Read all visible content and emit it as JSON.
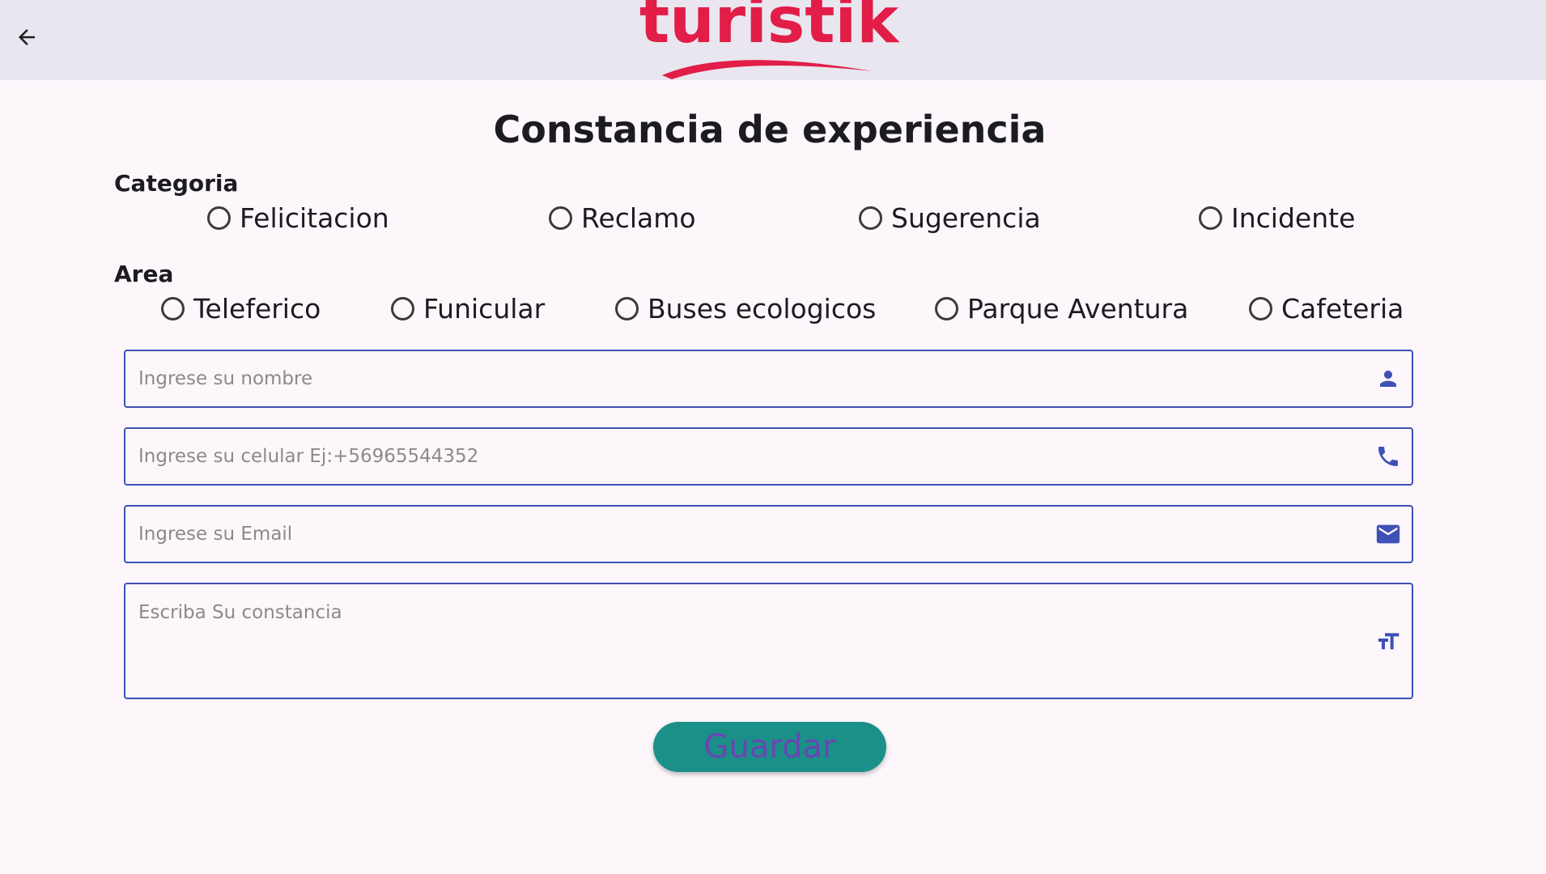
{
  "app_bar": {
    "logo_text": "turistik",
    "back_icon": "arrow-left-icon"
  },
  "page": {
    "title": "Constancia de experiencia"
  },
  "categoria": {
    "label": "Categoria",
    "options": [
      "Felicitacion",
      "Reclamo",
      "Sugerencia",
      "Incidente"
    ],
    "selected": null
  },
  "area": {
    "label": "Area",
    "options": [
      "Teleferico",
      "Funicular",
      "Buses ecologicos",
      "Parque Aventura",
      "Cafeteria"
    ],
    "selected": null
  },
  "form": {
    "nombre": {
      "placeholder": "Ingrese su nombre",
      "value": "",
      "icon": "person-icon"
    },
    "celular": {
      "placeholder": "Ingrese su celular Ej:+56965544352",
      "value": "",
      "icon": "phone-icon"
    },
    "email": {
      "placeholder": "Ingrese su Email",
      "value": "",
      "icon": "mail-icon"
    },
    "constancia": {
      "placeholder": "Escriba Su constancia",
      "value": "",
      "icon": "text-size-icon"
    }
  },
  "save_button": {
    "label": "Guardar"
  },
  "colors": {
    "app_bar_bg": "#e9e6ef",
    "page_bg": "#fdf7fc",
    "logo": "#e11d48",
    "field_border": "#3f51b5",
    "icon": "#3f51b5",
    "button_bg": "#1a9088",
    "button_text": "#6a45b5"
  }
}
